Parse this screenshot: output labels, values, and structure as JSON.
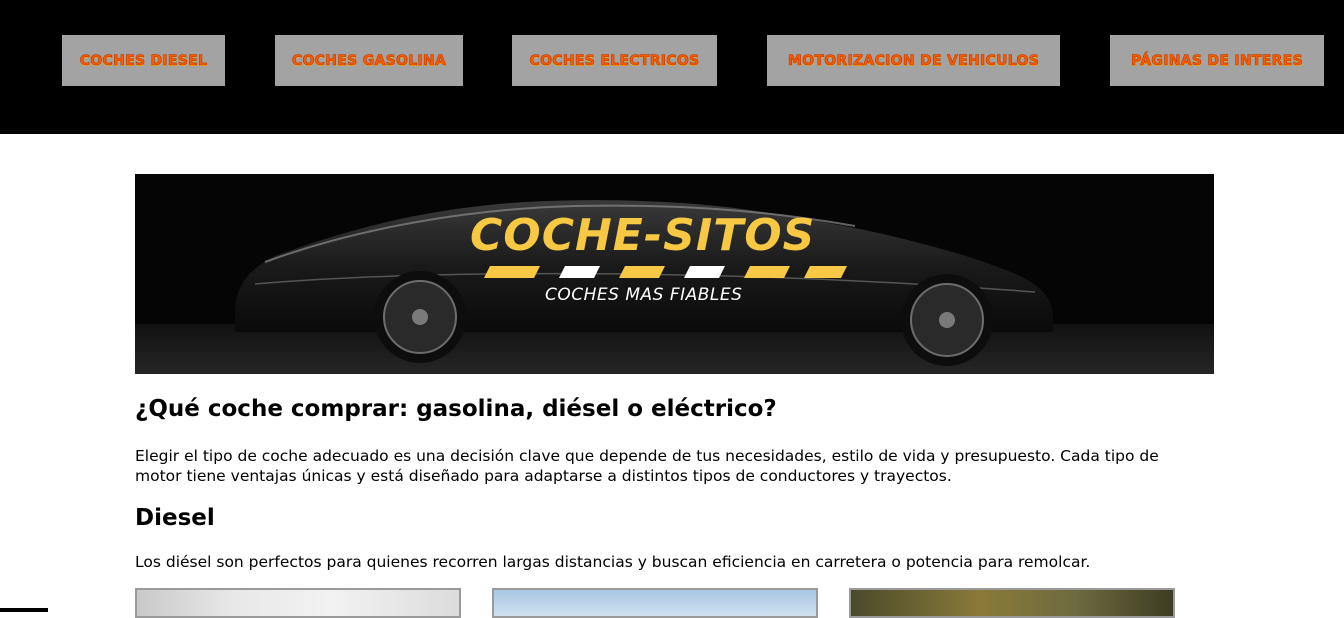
{
  "nav": {
    "items": [
      {
        "label": "COCHES DIESEL"
      },
      {
        "label": "COCHES GASOLINA"
      },
      {
        "label": "COCHES ELECTRICOS"
      },
      {
        "label": "MOTORIZACION DE VEHICULOS"
      },
      {
        "label": "PÁGINAS DE INTERES"
      }
    ],
    "button_bg": "#a3a3a3",
    "text_color": "#ff5a00"
  },
  "banner": {
    "title": "COCHE-SITOS",
    "subtitle": "COCHES MAS FIABLES",
    "title_color": "#f6c843"
  },
  "content": {
    "heading": "¿Qué coche comprar: gasolina, diésel o eléctrico?",
    "intro": "Elegir el tipo de coche adecuado es una decisión clave que depende de tus necesidades, estilo de vida y presupuesto. Cada tipo de motor tiene ventajas únicas y está diseñado para adaptarse a distintos tipos de conductores y trayectos.",
    "diesel_heading": "Diesel",
    "diesel_text": "Los diésel son perfectos para quienes recorren largas distancias y buscan eficiencia en carretera o potencia para remolcar."
  }
}
